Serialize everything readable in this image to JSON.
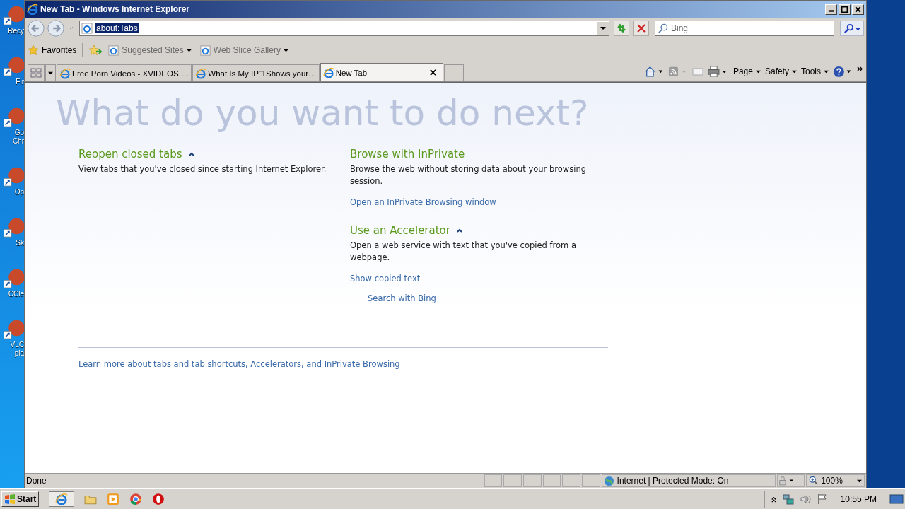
{
  "desktop_icons": [
    {
      "lines": [
        "Recy"
      ]
    },
    {
      "lines": [
        "Fir"
      ]
    },
    {
      "lines": [
        "Go",
        "Chr"
      ]
    },
    {
      "lines": [
        "Op"
      ]
    },
    {
      "lines": [
        "Sk"
      ]
    },
    {
      "lines": [
        "CCle"
      ]
    },
    {
      "lines": [
        "VLC",
        "pla"
      ]
    }
  ],
  "window": {
    "title": "New Tab - Windows Internet Explorer"
  },
  "address": {
    "value": "about:Tabs"
  },
  "search": {
    "placeholder": "Bing"
  },
  "favorites_bar": {
    "label": "Favorites",
    "items": [
      "Suggested Sites",
      "Web Slice Gallery"
    ]
  },
  "tabs": [
    {
      "label": "Free Porn Videos - XVIDEOS.…",
      "selected": false
    },
    {
      "label": "What Is My IP□ Shows your…",
      "selected": false
    },
    {
      "label": "New Tab",
      "selected": true
    }
  ],
  "command_bar": [
    "Page",
    "Safety",
    "Tools"
  ],
  "page": {
    "heading": "What do you want to do next?",
    "left": [
      {
        "title": "Reopen closed tabs",
        "expanded": true,
        "text": "View tabs that you've closed since starting Internet Explorer."
      }
    ],
    "right": [
      {
        "title": "Browse with InPrivate",
        "text": "Browse the web without storing data about your browsing session.",
        "links": [
          {
            "label": "Open an InPrivate Browsing window",
            "indent": false
          }
        ]
      },
      {
        "title": "Use an Accelerator",
        "expanded": true,
        "text": "Open a web service with text that you've copied from a webpage.",
        "links": [
          {
            "label": "Show copied text",
            "indent": false
          },
          {
            "label": "Search with Bing",
            "indent": true
          }
        ]
      }
    ],
    "footer_link": "Learn more about tabs and tab shortcuts, Accelerators, and InPrivate Browsing"
  },
  "status_bar": {
    "text": "Done",
    "zone": "Internet | Protected Mode: On",
    "zoom": "100%"
  },
  "taskbar": {
    "start": "Start",
    "clock": "10:55 PM"
  }
}
